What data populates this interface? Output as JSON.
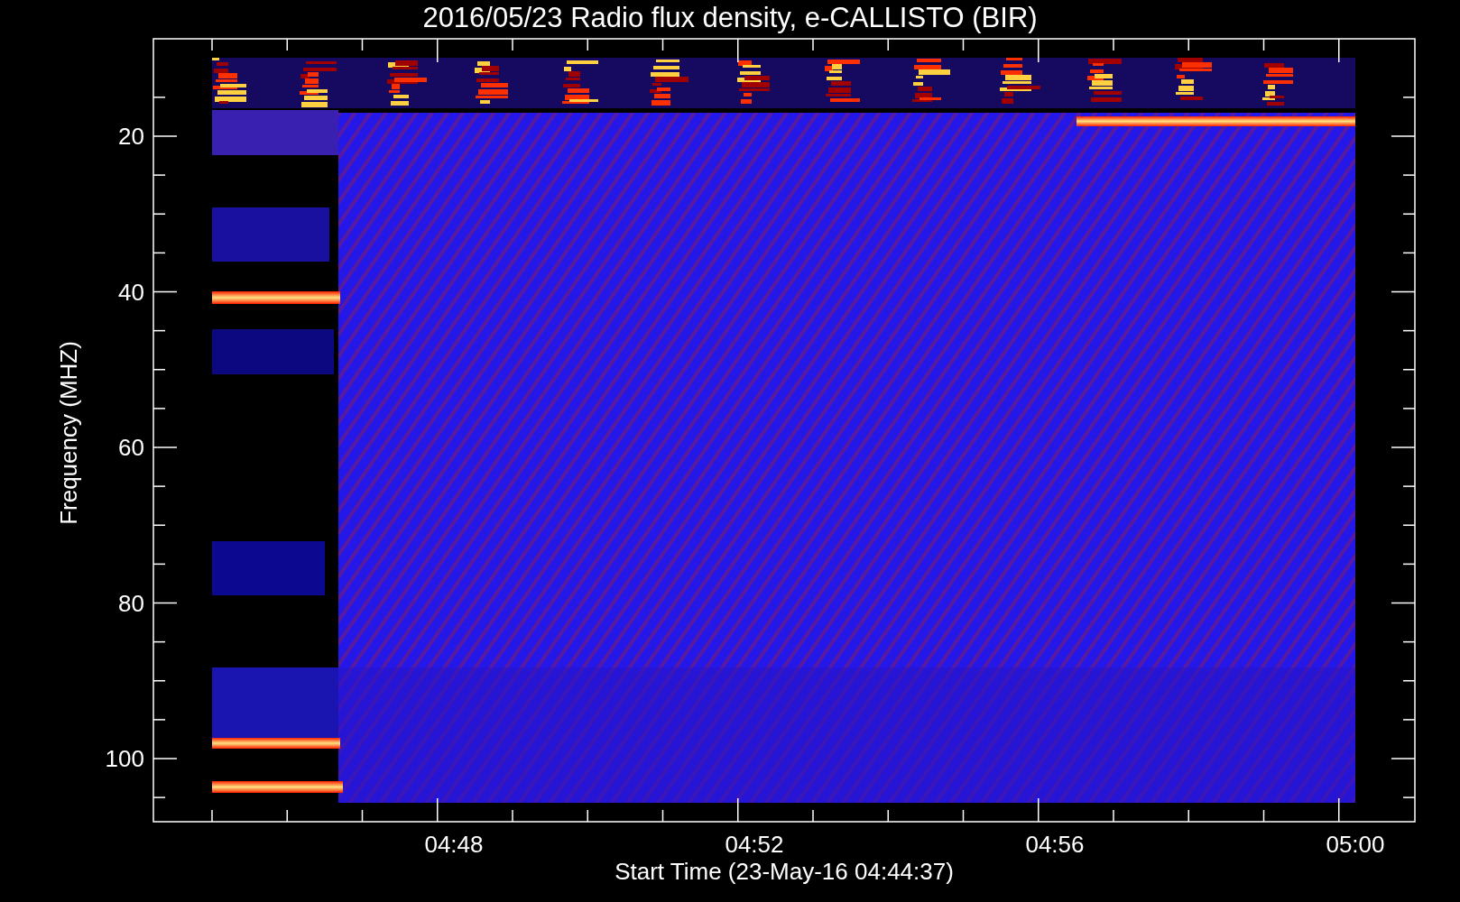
{
  "title": "2016/05/23  Radio flux density, e-CALLISTO (BIR)",
  "ylabel": "Frequency (MHZ)",
  "xlabel": "Start Time (23-May-16 04:44:37)",
  "yticks": [
    "20",
    "40",
    "60",
    "80",
    "100"
  ],
  "xticks": [
    "04:48",
    "04:52",
    "04:56",
    "05:00"
  ]
}
